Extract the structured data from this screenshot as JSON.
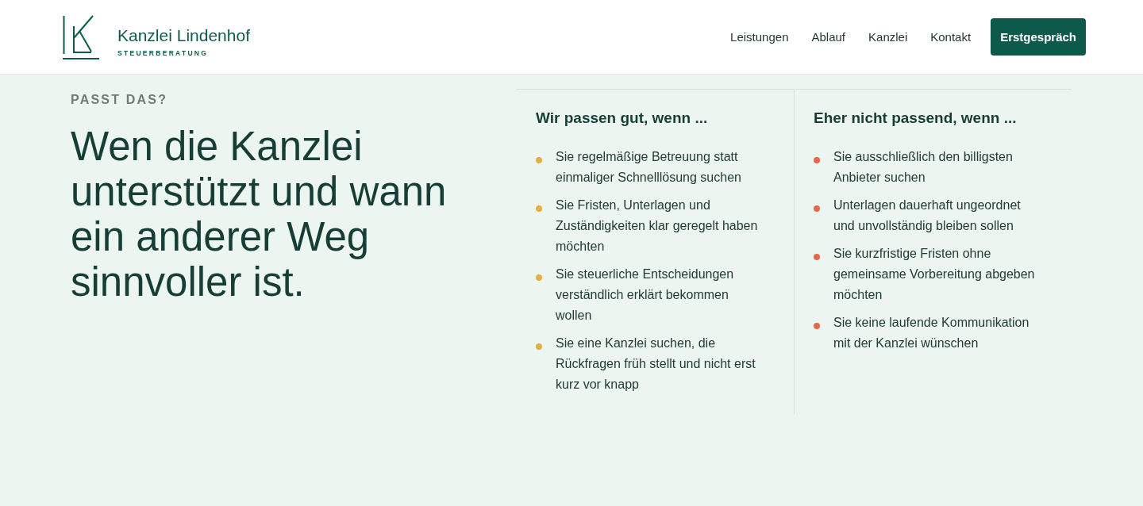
{
  "header": {
    "brand": {
      "name": "Kanzlei Lindenhof",
      "tagline": "STEUERBERATUNG"
    },
    "nav": [
      "Leistungen",
      "Ablauf",
      "Kanzlei",
      "Kontakt"
    ],
    "cta": "Erstgespräch"
  },
  "intro": {
    "eyebrow": "PASST DAS?",
    "heading": "Wen die Kanzlei unterstützt und wann ein anderer Weg sinnvoller ist."
  },
  "columns": [
    {
      "title": "Wir passen gut, wenn ...",
      "color": "#e2b041",
      "items": [
        "Sie regelmäßige Betreuung statt einmaliger Schnelllösung suchen",
        "Sie Fristen, Unterlagen und Zuständigkeiten klar geregelt haben möchten",
        "Sie steuerliche Entscheidungen verständlich erklärt bekommen wollen",
        "Sie eine Kanzlei suchen, die Rückfragen früh stellt und nicht erst kurz vor knapp"
      ]
    },
    {
      "title": "Eher nicht passend, wenn ...",
      "color": "#e5684b",
      "items": [
        "Sie ausschließlich den billigsten Anbieter suchen",
        "Unterlagen dauerhaft ungeordnet und unvollständig bleiben sollen",
        "Sie kurzfristige Fristen ohne gemeinsame Vorbereitung abgeben möchten",
        "Sie keine laufende Kommunikation mit der Kanzlei wünschen"
      ]
    }
  ]
}
